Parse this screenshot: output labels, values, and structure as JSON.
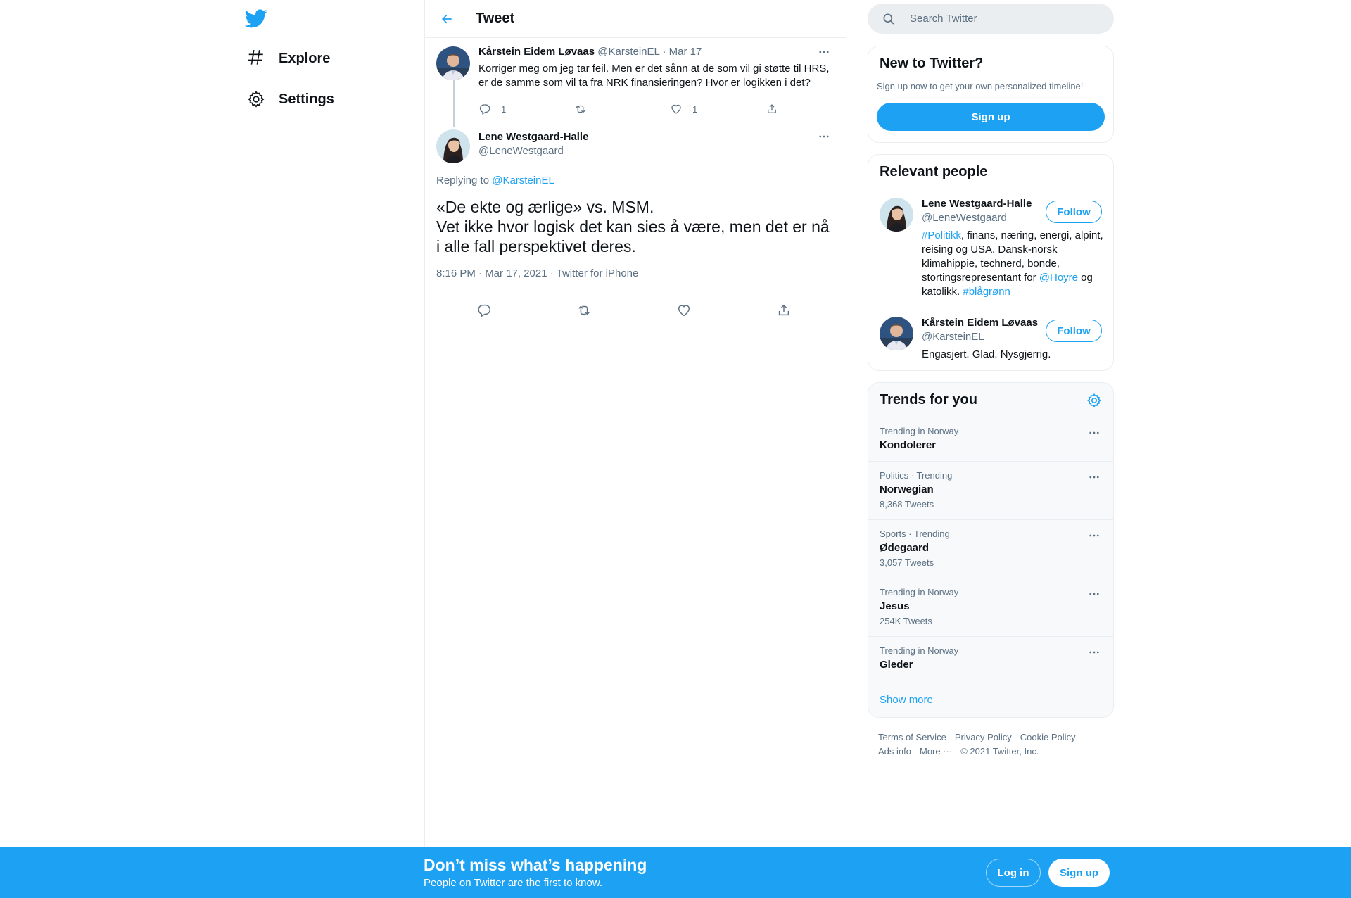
{
  "nav": {
    "items": [
      {
        "label": "Explore",
        "icon": "hashtag-icon"
      },
      {
        "label": "Settings",
        "icon": "gear-icon"
      }
    ]
  },
  "main": {
    "title": "Tweet",
    "parent_tweet": {
      "name": "Kårstein Eidem Løvaas",
      "handle": "@KarsteinEL",
      "date": "· Mar 17",
      "text": "Korriger meg om jeg tar feil. Men er det sånn at de som vil gi støtte til HRS, er de samme som vil ta fra NRK finansieringen? Hvor er logikken i det?",
      "reply_count": "1",
      "like_count": "1"
    },
    "focal_tweet": {
      "name": "Lene Westgaard-Halle",
      "handle": "@LeneWestgaard",
      "replying_prefix": "Replying to",
      "replying_to": "@KarsteinEL",
      "text": "«De ekte og ærlige» vs. MSM.\nVet ikke hvor logisk det kan sies å være, men det er nå i alle fall perspektivet deres.",
      "meta": "8:16 PM · Mar 17, 2021 · Twitter for iPhone"
    }
  },
  "search": {
    "placeholder": "Search Twitter"
  },
  "new_to_twitter": {
    "title": "New to Twitter?",
    "subtitle": "Sign up now to get your own personalized timeline!",
    "button": "Sign up"
  },
  "relevant_people": {
    "title": "Relevant people",
    "people": [
      {
        "name": "Lene Westgaard-Halle",
        "handle": "@LeneWestgaard",
        "follow": "Follow",
        "bio_parts": [
          "#Politikk",
          ", finans, næring, energi, alpint, reising og USA. Dansk-norsk klimahippie, technerd, bonde, stortingsrepresentant for ",
          "@Hoyre",
          " og katolikk. ",
          "#blågrønn"
        ]
      },
      {
        "name": "Kårstein Eidem Løvaas",
        "handle": "@KarsteinEL",
        "follow": "Follow",
        "bio": "Engasjert. Glad. Nysgjerrig."
      }
    ]
  },
  "trends": {
    "title": "Trends for you",
    "items": [
      {
        "context": "Trending in Norway",
        "name": "Kondolerer",
        "count": ""
      },
      {
        "context": "Politics · Trending",
        "name": "Norwegian",
        "count": "8,368 Tweets"
      },
      {
        "context": "Sports · Trending",
        "name": "Ødegaard",
        "count": "3,057 Tweets"
      },
      {
        "context": "Trending in Norway",
        "name": "Jesus",
        "count": "254K Tweets"
      },
      {
        "context": "Trending in Norway",
        "name": "Gleder",
        "count": ""
      }
    ],
    "show_more": "Show more"
  },
  "footer": {
    "links": [
      "Terms of Service",
      "Privacy Policy",
      "Cookie Policy",
      "Ads info",
      "More ···"
    ],
    "copyright": "© 2021 Twitter, Inc."
  },
  "bottom_bar": {
    "title": "Don’t miss what’s happening",
    "subtitle": "People on Twitter are the first to know.",
    "login": "Log in",
    "signup": "Sign up"
  },
  "colors": {
    "accent": "#1da1f2",
    "text": "#0f1419",
    "secondary": "#5b7083",
    "border": "#ebeef0"
  }
}
